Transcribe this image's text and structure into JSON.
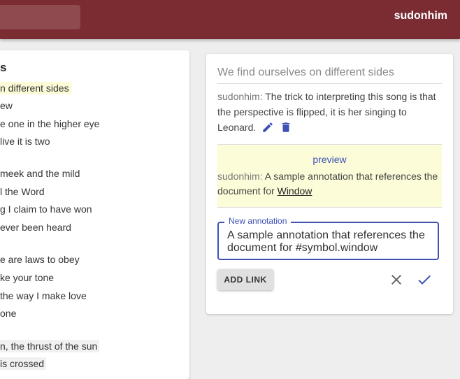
{
  "appbar": {
    "username": "sudonhim",
    "colors": {
      "appbar": "#7a2c32",
      "accent": "#3f51b5",
      "highlight": "#fcfbd8"
    }
  },
  "lyrics": {
    "title_fragment": "s",
    "lines": [
      {
        "text": "n different sides",
        "style": "highlight"
      },
      {
        "text": "ew",
        "style": "plain"
      },
      {
        "text": "e one in the higher eye",
        "style": "plain"
      },
      {
        "text": " live it is two",
        "style": "plain"
      },
      {
        "text": " meek and the mild",
        "style": "plain"
      },
      {
        "text": "l the Word",
        "style": "plain"
      },
      {
        "text": "g I claim to have won",
        "style": "plain"
      },
      {
        "text": "ever been heard",
        "style": "plain"
      },
      {
        "text": "e are laws to obey",
        "style": "plain"
      },
      {
        "text": "ke your tone",
        "style": "plain"
      },
      {
        "text": " the way I make love",
        "style": "plain"
      },
      {
        "text": "one",
        "style": "plain"
      },
      {
        "text": "n, the thrust of the sun",
        "style": "gray"
      },
      {
        "text": " is crossed",
        "style": "gray"
      }
    ]
  },
  "annotation": {
    "header": "We find ourselves on different sides",
    "existing": {
      "author": "sudonhim:",
      "text": " The trick to interpreting this song is that the perspective is flipped, it is her singing to Leonard.",
      "edit_icon": "pencil-icon",
      "delete_icon": "trash-icon"
    },
    "preview": {
      "label": "preview",
      "author": "sudonhim:",
      "text": " A sample annotation that references the document for ",
      "link_text": "Window"
    },
    "new_field": {
      "label": "New annotation",
      "value": "A sample annotation that references the document for #symbol.window"
    },
    "actions": {
      "add_link_label": "ADD LINK",
      "cancel_icon": "close-icon",
      "confirm_icon": "check-icon"
    }
  }
}
